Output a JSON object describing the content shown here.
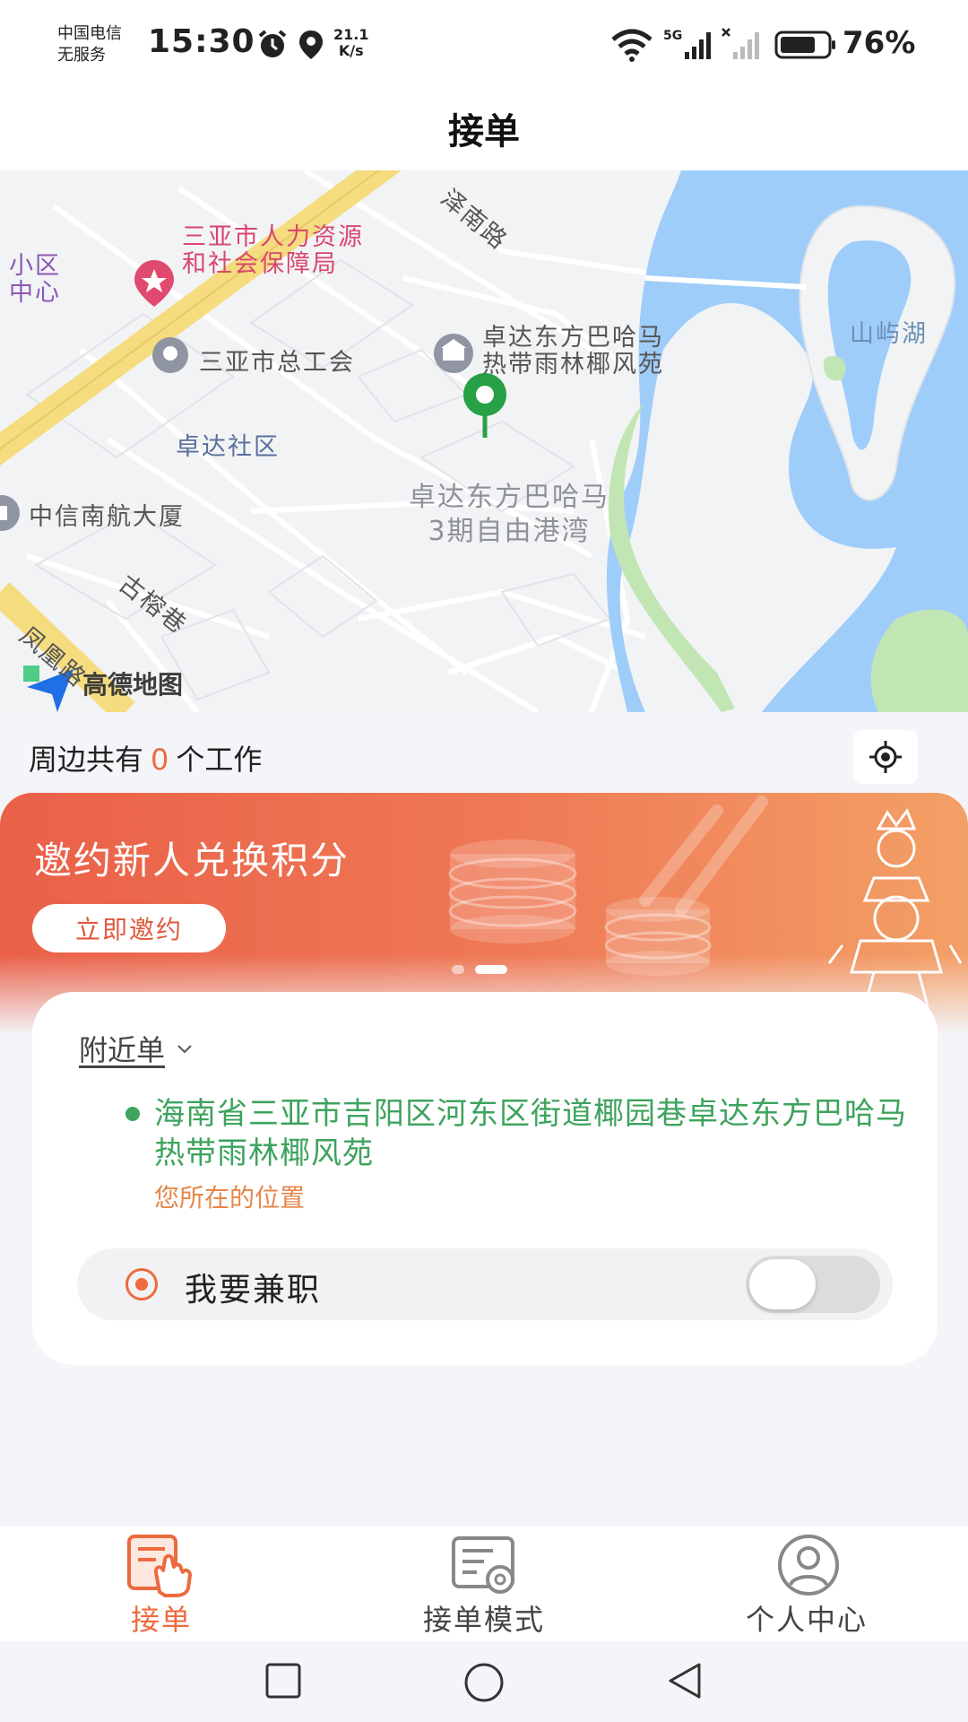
{
  "status_bar": {
    "carrier_line1": "中国电信",
    "carrier_line2": "无服务",
    "time": "15:30",
    "net_speed_value": "21.1",
    "net_speed_unit": "K/s",
    "battery_percent": "76%",
    "icons": [
      "alarm-icon",
      "location-icon",
      "wifi-icon",
      "signal-5g-icon",
      "signal-none-icon",
      "battery-icon"
    ]
  },
  "header": {
    "title": "接单"
  },
  "map": {
    "labels": {
      "hr_bureau_line1": "三亚市人力资源",
      "hr_bureau_line2": "和社会保障局",
      "district_line1": "小区",
      "district_line2": "中心",
      "road_north": "泽南路",
      "lake": "山屿湖",
      "trade_union": "三亚市总工会",
      "resort_line1": "卓达东方巴哈马",
      "resort_line2": "热带雨林椰风苑",
      "community": "卓达社区",
      "citic_building": "中信南航大厦",
      "phase3_line1": "卓达东方巴哈马",
      "phase3_line2": "3期自由港湾",
      "lane": "古榕巷",
      "phoenix_road": "凤凰路",
      "amap_brand": "高德地图"
    },
    "colors": {
      "water": "#9fcdfa",
      "road_major": "#f5dc7e",
      "park": "#c2e6b3",
      "marker": "#27a046"
    }
  },
  "nearby": {
    "prefix": "周边共有",
    "count": "0",
    "suffix": "个工作"
  },
  "banner": {
    "title": "邀约新人兑换积分",
    "button": "立即邀约",
    "slide_count": 2,
    "active_slide": 2
  },
  "card": {
    "selector_label": "附近单",
    "address": "海南省三亚市吉阳区河东区街道椰园巷卓达东方巴哈马热带雨林椰风苑",
    "address_hint": "您所在的位置",
    "parttime_label": "我要兼职",
    "parttime_enabled": false
  },
  "tabs": [
    {
      "label": "接单",
      "icon": "hand-touch-icon",
      "active": true
    },
    {
      "label": "接单模式",
      "icon": "settings-doc-icon",
      "active": false
    },
    {
      "label": "个人中心",
      "icon": "user-icon",
      "active": false
    }
  ],
  "accent_color": "#ec6a3e"
}
